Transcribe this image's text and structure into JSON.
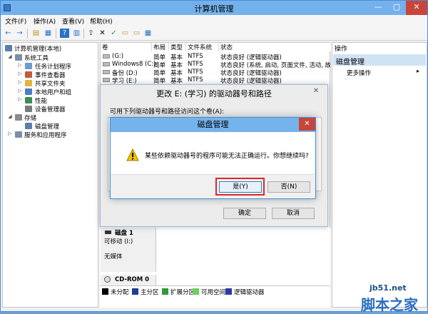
{
  "window": {
    "title": "计算机管理",
    "min": "—",
    "max": "▢",
    "close": "✕"
  },
  "menu": [
    "文件(F)",
    "操作(A)",
    "查看(V)",
    "帮助(H)"
  ],
  "toolbar_icons": [
    "←",
    "→",
    "▤",
    "▦",
    "?",
    "▥",
    "⇪",
    "✕",
    "✓",
    "▭",
    "▭",
    "▦"
  ],
  "tree": {
    "root": "计算机管理(本地)",
    "items": [
      {
        "label": "系统工具",
        "level": 1,
        "expander": "◢",
        "color": "#7a8fa8"
      },
      {
        "label": "任务计划程序",
        "level": 2,
        "expander": "▷",
        "color": "#6b9bd1"
      },
      {
        "label": "事件查看器",
        "level": 2,
        "expander": "▷",
        "color": "#c45b3c"
      },
      {
        "label": "共享文件夹",
        "level": 2,
        "expander": "▷",
        "color": "#e0b640"
      },
      {
        "label": "本地用户和组",
        "level": 2,
        "expander": "▷",
        "color": "#4a7fc1"
      },
      {
        "label": "性能",
        "level": 2,
        "expander": "▷",
        "color": "#3c8f4e"
      },
      {
        "label": "设备管理器",
        "level": 2,
        "expander": "",
        "color": "#7a7a7a"
      },
      {
        "label": "存储",
        "level": 1,
        "expander": "◢",
        "color": "#8a8a8a"
      },
      {
        "label": "磁盘管理",
        "level": 2,
        "expander": "",
        "color": "#5a7fa8",
        "selected": true
      },
      {
        "label": "服务和应用程序",
        "level": 1,
        "expander": "▷",
        "color": "#7a8fa8"
      }
    ]
  },
  "volumes": {
    "headers": [
      "卷",
      "布局",
      "类型",
      "文件系统",
      "状态"
    ],
    "rows": [
      {
        "name": "(G:)",
        "layout": "简单",
        "type": "基本",
        "fs": "NTFS",
        "status": "状态良好 (逻辑驱动器)"
      },
      {
        "name": "Windows8 (C:)",
        "layout": "简单",
        "type": "基本",
        "fs": "NTFS",
        "status": "状态良好 (系统, 启动, 页面文件, 活动, 故障"
      },
      {
        "name": "备份 (D:)",
        "layout": "简单",
        "type": "基本",
        "fs": "NTFS",
        "status": "状态良好 (逻辑驱动器)"
      },
      {
        "name": "学习 (E:)",
        "layout": "简单",
        "type": "基本",
        "fs": "NTFS",
        "status": "状态良好 (逻辑驱动器)"
      }
    ]
  },
  "actions": {
    "title": "操作",
    "section": "磁盘管理",
    "more": "更多操作",
    "arrow": "▸"
  },
  "disks": {
    "disk1_name": "磁盘 1",
    "disk1_type": "可移动 (I:)",
    "disk1_media": "无媒体",
    "cdrom_name": "CD-ROM 0"
  },
  "legend": [
    {
      "label": "未分配",
      "color": "#000000"
    },
    {
      "label": "主分区",
      "color": "#1c3f8f"
    },
    {
      "label": "扩展分区",
      "color": "#2e9c3a"
    },
    {
      "label": "可用空间",
      "color": "#6cd05a"
    },
    {
      "label": "逻辑驱动器",
      "color": "#2a3aa8"
    }
  ],
  "change_dialog": {
    "title": "更改 E: (学习) 的驱动器号和路径",
    "prompt": "可用下列驱动器号和路径访问这个卷(A):",
    "ok": "确定",
    "cancel": "取消",
    "close": "✕"
  },
  "confirm_dialog": {
    "title": "磁盘管理",
    "message": "某些依赖驱动器号的程序可能无法正确运行。你想继续吗?",
    "yes": "是(Y)",
    "no": "否(N)",
    "close": "✕"
  },
  "watermark": {
    "url": "jb51.net",
    "name": "脚本之家"
  }
}
